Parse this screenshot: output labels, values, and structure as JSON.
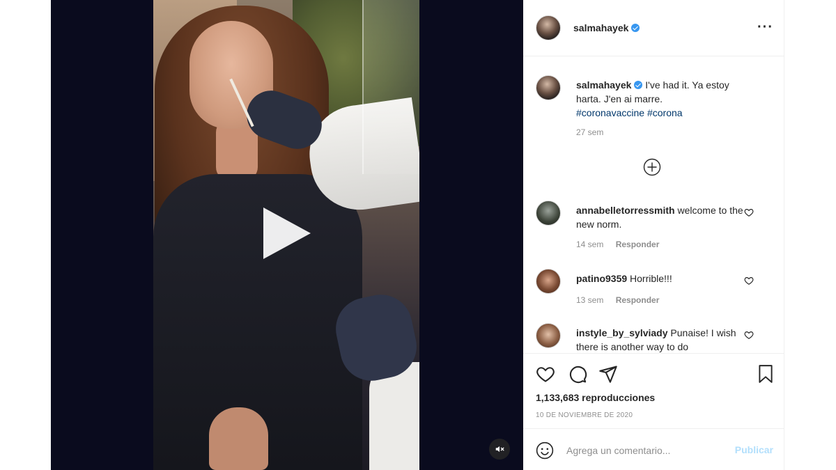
{
  "post": {
    "username": "salmahayek",
    "verified": true,
    "more_icon": "more-horizontal-icon"
  },
  "caption": {
    "username": "salmahayek",
    "text": "I've had it. Ya estoy harta. J'en ai marre.",
    "hashtags": [
      "#coronavaccine",
      "#corona"
    ],
    "time": "27 sem"
  },
  "load_more_icon": "plus-circle-icon",
  "comments": [
    {
      "username": "annabelletorressmith",
      "text": "welcome to the new norm.",
      "time": "14 sem",
      "reply_label": "Responder"
    },
    {
      "username": "patino9359",
      "text": "Horrible!!!",
      "time": "13 sem",
      "reply_label": "Responder"
    },
    {
      "username": "instyle_by_sylviady",
      "text": "Punaise! I wish there is another way to do"
    }
  ],
  "stats": {
    "views": "1,133,683 reproducciones",
    "date": "10 DE NOVIEMBRE DE 2020"
  },
  "add_comment": {
    "placeholder": "Agrega un comentario...",
    "publish_label": "Publicar"
  },
  "colors": {
    "video_bg": "#0a0b1e",
    "verified_blue": "#3897f0",
    "hashtag": "#00376b",
    "publish_disabled": "#b2dffc",
    "muted_text": "#8e8e8e"
  }
}
